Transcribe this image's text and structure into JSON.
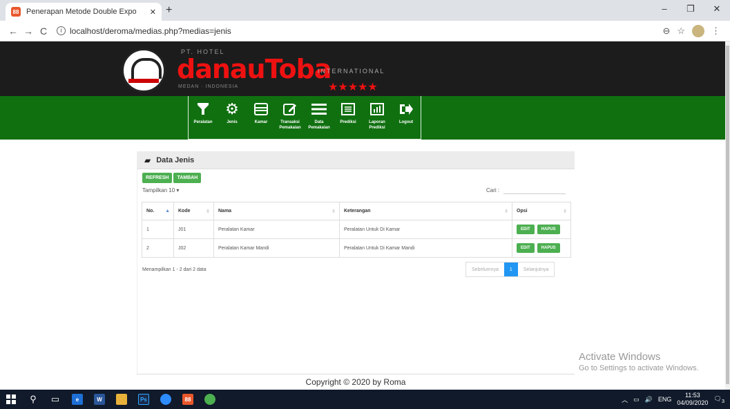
{
  "browser": {
    "tab_title": "Penerapan Metode Double Expo",
    "tab_favicon": "88",
    "url": "localhost/deroma/medias.php?medias=jenis",
    "icons": [
      "back-arrow-icon",
      "forward-arrow-icon",
      "reload-icon",
      "info-icon",
      "zoom-icon",
      "star-icon",
      "menu-icon"
    ]
  },
  "header": {
    "brand_small": "PT. HOTEL",
    "brand_name": "danauToba",
    "brand_intl": "INTERNATIONAL",
    "tagline": "MEDAN · INDONESIA",
    "stars": "★★★★★"
  },
  "nav": {
    "items": [
      {
        "label": "Peralatan",
        "icon": "filter-icon"
      },
      {
        "label": "Jenis",
        "icon": "cogs-icon"
      },
      {
        "label": "Kamar",
        "icon": "card-icon"
      },
      {
        "label": "Transaksi Pemakaian",
        "icon": "edit-icon"
      },
      {
        "label": "Data Pemakaian",
        "icon": "list-icon"
      },
      {
        "label": "Prediksi",
        "icon": "list-alt-icon"
      },
      {
        "label": "Laporan Prediksi",
        "icon": "chart-icon"
      },
      {
        "label": "Logout",
        "icon": "logout-icon"
      }
    ]
  },
  "panel": {
    "title": "Data Jenis",
    "refresh_label": "REFRESH",
    "add_label": "TAMBAH",
    "length_label": "Tampilkan 10 ▾",
    "search_label": "Cari :",
    "table": {
      "headers": [
        "No.",
        "Kode",
        "Nama",
        "Keterangan",
        "Opsi"
      ],
      "rows": [
        {
          "no": "1",
          "kode": "J01",
          "nama": "Peralatan Kamar",
          "keterangan": "Peralatan Untuk Di Kamar"
        },
        {
          "no": "2",
          "kode": "J02",
          "nama": "Peralatan Kamar Mandi",
          "keterangan": "Peralatan Untuk Di Kamar Mandi"
        }
      ],
      "edit_label": "EDIT",
      "delete_label": "HAPUS"
    },
    "info": "Menampilkan 1 - 2 dari 2 data",
    "pager": {
      "prev": "Sebelumnya",
      "current": "1",
      "next": "Selanjutnya"
    }
  },
  "footer": "Copyright © 2020 by Roma",
  "watermark": {
    "line1": "Activate Windows",
    "line2": "Go to Settings to activate Windows."
  },
  "taskbar": {
    "lang": "ENG",
    "time": "11:53",
    "date": "04/09/2020",
    "notif": "3"
  }
}
